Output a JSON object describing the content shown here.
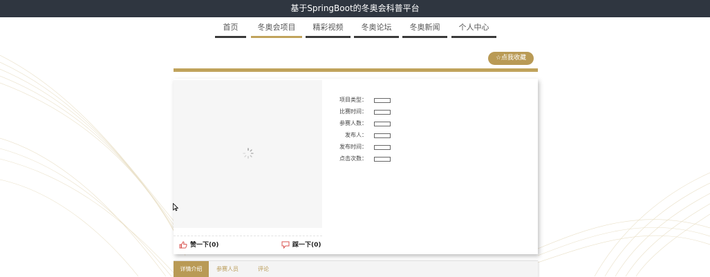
{
  "header": {
    "title": "基于SpringBoot的冬奥会科普平台"
  },
  "nav": {
    "items": [
      {
        "label": "首页",
        "active": false
      },
      {
        "label": "冬奥会项目",
        "active": true
      },
      {
        "label": "精彩视频",
        "active": false
      },
      {
        "label": "冬奥论坛",
        "active": false
      },
      {
        "label": "冬奥新闻",
        "active": false
      },
      {
        "label": "个人中心",
        "active": false
      }
    ]
  },
  "favorite_button": {
    "label": "☆点我收藏"
  },
  "details": {
    "fields": [
      {
        "label": "项目类型：",
        "value": ""
      },
      {
        "label": "比赛时间：",
        "value": ""
      },
      {
        "label": "参赛人数：",
        "value": ""
      },
      {
        "label": "发布人：",
        "value": ""
      },
      {
        "label": "发布时间：",
        "value": ""
      },
      {
        "label": "点击次数：",
        "value": ""
      }
    ]
  },
  "votes": {
    "like_label": "赞一下(0)",
    "dislike_label": "踩一下(0)"
  },
  "tabs": [
    {
      "label": "详情介绍",
      "active": true
    },
    {
      "label": "参赛人员",
      "active": false
    },
    {
      "label": "评论",
      "active": false
    }
  ],
  "colors": {
    "topbar": "#2f3640",
    "accent_gold": "#c0a35b",
    "nav_bar_dark": "#3a3a3a",
    "button_gold": "#b99a55",
    "thumb_up_red": "#d9534f"
  }
}
